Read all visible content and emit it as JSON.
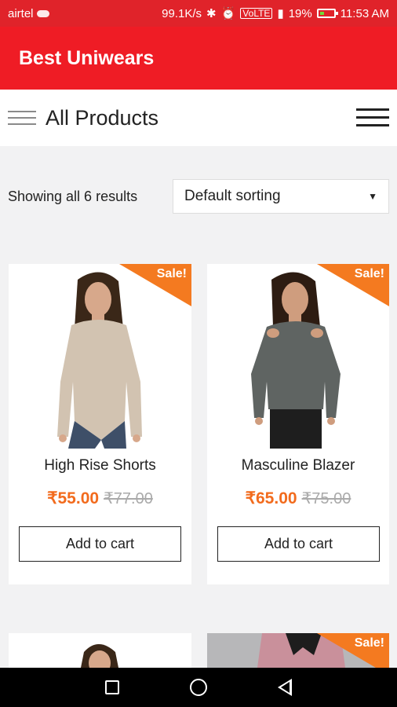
{
  "status_bar": {
    "carrier": "airtel",
    "speed": "99.1K/s",
    "volte": "VoLTE",
    "signal": "4G",
    "battery": "19%",
    "time": "11:53 AM"
  },
  "app": {
    "title": "Best Uniwears"
  },
  "subheader": {
    "title": "All Products"
  },
  "shop": {
    "result_count": "Showing all 6 results",
    "sorting": {
      "selected": "Default sorting"
    }
  },
  "products": [
    {
      "name": "High Rise Shorts",
      "price": "₹55.00",
      "old_price": "₹77.00",
      "badge": "Sale!",
      "button": "Add to cart",
      "colors": {
        "top": "#d2c3b1",
        "pants": "#3e4f68",
        "hair": "#3a2718",
        "skin": "#d7a88b"
      }
    },
    {
      "name": "Masculine Blazer",
      "price": "₹65.00",
      "old_price": "₹75.00",
      "badge": "Sale!",
      "button": "Add to cart",
      "colors": {
        "top": "#5f6462",
        "pants": "#1e1e1e",
        "hair": "#2d1c12",
        "skin": "#cf9d7e"
      }
    },
    {
      "badge": ""
    },
    {
      "badge": "Sale!"
    }
  ],
  "theme": {
    "statusbar": "#e0232a",
    "appbar": "#ef1c25",
    "sale": "#f47a20",
    "price": "#f26b1d"
  }
}
